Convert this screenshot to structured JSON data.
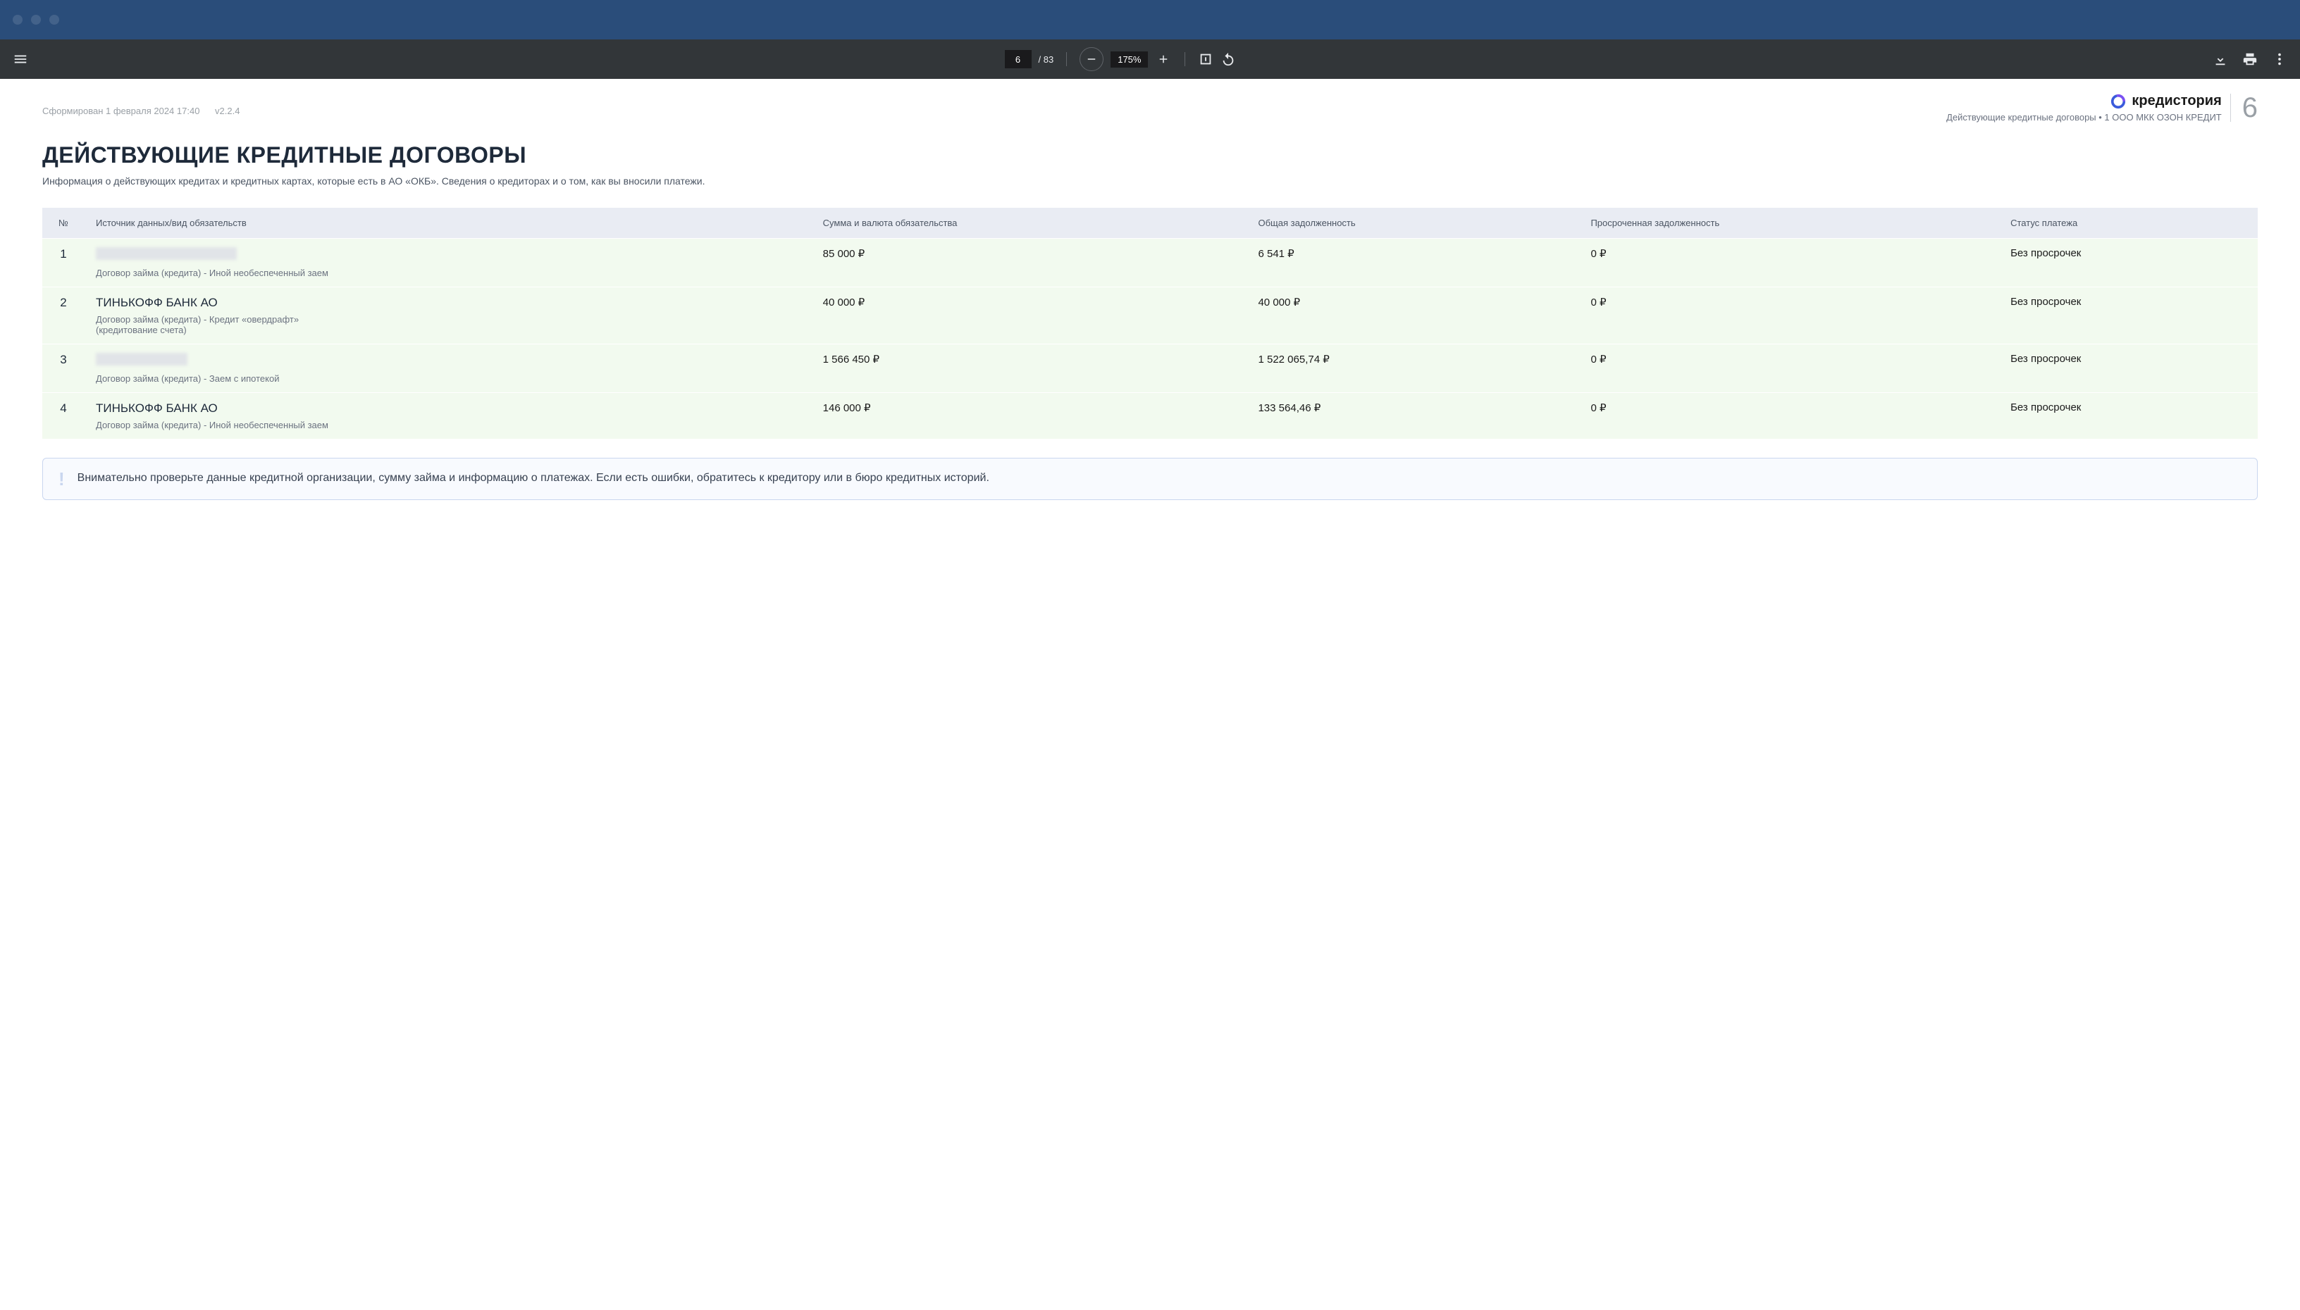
{
  "toolbar": {
    "current_page": "6",
    "total_pages": "/ 83",
    "zoom": "175%"
  },
  "doc": {
    "generated": "Сформирован 1 февраля 2024 17:40",
    "version": "v2.2.4",
    "brand": "кредистория",
    "breadcrumb": "Действующие кредитные договоры • 1 ООО МКК ОЗОН КРЕДИТ",
    "page_number": "6",
    "title": "ДЕЙСТВУЮЩИЕ КРЕДИТНЫЕ ДОГОВОРЫ",
    "subtitle": "Информация о действующих кредитах и кредитных картах, которые есть в АО «ОКБ». Сведения о кредиторах и о том, как вы вносили платежи."
  },
  "table": {
    "headers": {
      "num": "№",
      "source": "Источник данных/вид обязательств",
      "amount": "Сумма и валюта обязательства",
      "total_debt": "Общая задолженность",
      "overdue": "Просроченная задолженность",
      "status": "Статус платежа"
    },
    "rows": [
      {
        "n": "1",
        "name_redacted": true,
        "name": "",
        "sub": "Договор займа (кредита) - Иной необеспеченный заем",
        "amount": "85 000 ₽",
        "debt": "6 541 ₽",
        "overdue": "0 ₽",
        "status": "Без просрочек"
      },
      {
        "n": "2",
        "name_redacted": false,
        "name": "ТИНЬКОФФ БАНК АО",
        "sub": "Договор займа (кредита) - Кредит «овердрафт» (кредитование счета)",
        "amount": "40 000 ₽",
        "debt": "40 000 ₽",
        "overdue": "0 ₽",
        "status": "Без просрочек"
      },
      {
        "n": "3",
        "name_redacted": true,
        "name": "",
        "sub": "Договор займа (кредита) - Заем с ипотекой",
        "amount": "1 566 450 ₽",
        "debt": "1 522 065,74 ₽",
        "overdue": "0 ₽",
        "status": "Без просрочек"
      },
      {
        "n": "4",
        "name_redacted": false,
        "name": "ТИНЬКОФФ БАНК АО",
        "sub": "Договор займа (кредита) - Иной необеспеченный заем",
        "amount": "146 000 ₽",
        "debt": "133 564,46 ₽",
        "overdue": "0 ₽",
        "status": "Без просрочек"
      }
    ]
  },
  "notice": {
    "text": "Внимательно проверьте данные кредитной организации, сумму займа и информацию о платежах. Если есть ошибки, обратитесь к кредитору или в бюро кредитных историй."
  }
}
